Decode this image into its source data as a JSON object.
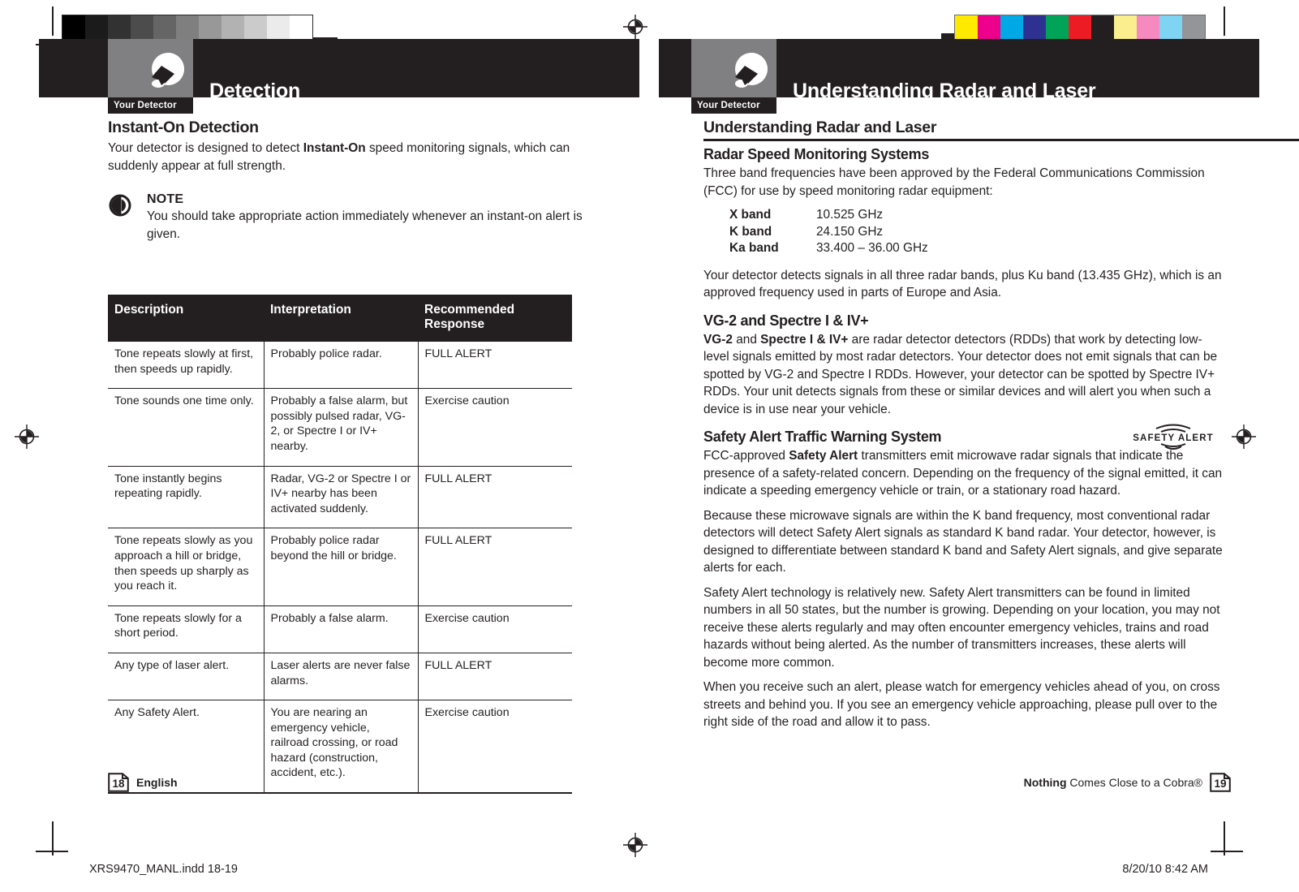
{
  "print_marks": {
    "gray_bar": {
      "name": "grayscale-calibration-bar",
      "swatches": [
        "#000000",
        "#1c1b1b",
        "#333232",
        "#4d4c4c",
        "#666565",
        "#807f7f",
        "#999898",
        "#b3b2b2",
        "#cccbcb",
        "#ebebeb",
        "#ffffff"
      ]
    },
    "color_bar": {
      "name": "color-calibration-bar",
      "swatches": [
        "#fdea00",
        "#ec008c",
        "#00a9e6",
        "#2e3192",
        "#00a357",
        "#ed1c24",
        "#231f20",
        "#faee8e",
        "#f689c0",
        "#7fd4f4",
        "#939598"
      ]
    },
    "registration": "registration-target",
    "slug_file": "XRS9470_MANL.indd   18-19",
    "slug_date": "8/20/10   8:42 AM"
  },
  "left_page": {
    "header": {
      "tab_label": "Your Detector",
      "title": "Detection",
      "icon": "detector-icon"
    },
    "heading": "Instant-On Detection",
    "intro_parts": [
      "Your detector is designed to detect ",
      "Instant-On",
      " speed monitoring signals, which can suddenly appear at full strength."
    ],
    "note": {
      "icon": "note-icon",
      "title": "NOTE",
      "body": "You should take appropriate action immediately whenever an instant-on alert is given."
    },
    "table": {
      "columns": [
        "Description",
        "Interpretation",
        "Recommended Response"
      ],
      "rows": [
        [
          "Tone repeats slowly at first, then speeds up rapidly.",
          "Probably police radar.",
          "FULL ALERT"
        ],
        [
          "Tone sounds one time only.",
          "Probably a false alarm, but possibly pulsed radar, VG-2, or Spectre I or IV+ nearby.",
          "Exercise caution"
        ],
        [
          "Tone instantly begins repeating rapidly.",
          "Radar, VG-2 or Spectre I or IV+ nearby has been activated suddenly.",
          "FULL ALERT"
        ],
        [
          "Tone repeats slowly as you approach a hill or bridge, then speeds up sharply as you reach it.",
          "Probably police radar beyond the hill or bridge.",
          "FULL ALERT"
        ],
        [
          "Tone repeats slowly for a short period.",
          "Probably a false alarm.",
          "Exercise caution"
        ],
        [
          "Any type of laser alert.",
          "Laser alerts are never false alarms.",
          "FULL ALERT"
        ],
        [
          "Any Safety Alert.",
          "You are nearing an emergency vehicle, railroad crossing, or road hazard (construction, accident, etc.).",
          "Exercise caution"
        ]
      ]
    },
    "footer": {
      "page_number": "18",
      "label": "English"
    }
  },
  "right_page": {
    "header": {
      "tab_label": "Your Detector",
      "title": "Understanding Radar and Laser",
      "icon": "detector-icon"
    },
    "heading": "Understanding Radar and Laser",
    "radar_section": {
      "heading": "Radar Speed Monitoring Systems",
      "intro": "Three band frequencies have been approved by the Federal Communications Commission (FCC) for use by speed monitoring radar equipment:",
      "bands": [
        {
          "name": "X band",
          "freq": "10.525 GHz"
        },
        {
          "name": "K band",
          "freq": "24.150 GHz"
        },
        {
          "name": "Ka band",
          "freq": "33.400 – 36.00 GHz"
        }
      ],
      "outro": "Your detector detects signals in all three radar bands, plus Ku band (13.435 GHz), which is an approved frequency used in parts of Europe and Asia."
    },
    "vg2_section": {
      "heading": "VG-2 and Spectre I & IV+",
      "parts": [
        "VG-2",
        " and ",
        "Spectre I & IV+",
        " are radar detector detectors (RDDs) that work by detecting low-level signals emitted by most radar detectors. Your detector does not emit signals that can be spotted by VG-2 and Spectre I RDDs. However, your detector can be spotted by Spectre IV+ RDDs. Your unit detects signals from these or similar devices and will alert you when such a device is in use near your vehicle."
      ]
    },
    "safety_section": {
      "heading": "Safety Alert Traffic Warning System",
      "logo_text": "SAFETY ALERT",
      "para1_parts": [
        "FCC-approved ",
        "Safety Alert",
        " transmitters emit microwave radar signals that indicate the presence of a safety-related concern. Depending on the frequency of the signal emitted, it can indicate a speeding emergency vehicle or train, or a stationary road hazard."
      ],
      "para2": "Because these microwave signals are within the K band frequency, most conventional radar detectors will detect Safety Alert signals as standard K band radar. Your detector, however, is designed to differentiate between standard K band and Safety Alert signals, and give separate alerts for each.",
      "para3": "Safety Alert technology is relatively new. Safety Alert transmitters can be found in limited numbers in all 50 states, but the number is growing. Depending on your location, you may not receive these alerts regularly and may often encounter emergency vehicles, trains and road hazards without being alerted. As the number of transmitters increases, these alerts will become more common.",
      "para4": "When you receive such an alert, please watch for emergency vehicles ahead of you, on cross streets and behind you. If you see an emergency vehicle approaching, please pull over to the right side of the road and allow it to pass."
    },
    "footer": {
      "tagline_bold": "Nothing",
      "tagline_rest": " Comes Close to a Cobra®",
      "page_number": "19"
    }
  }
}
